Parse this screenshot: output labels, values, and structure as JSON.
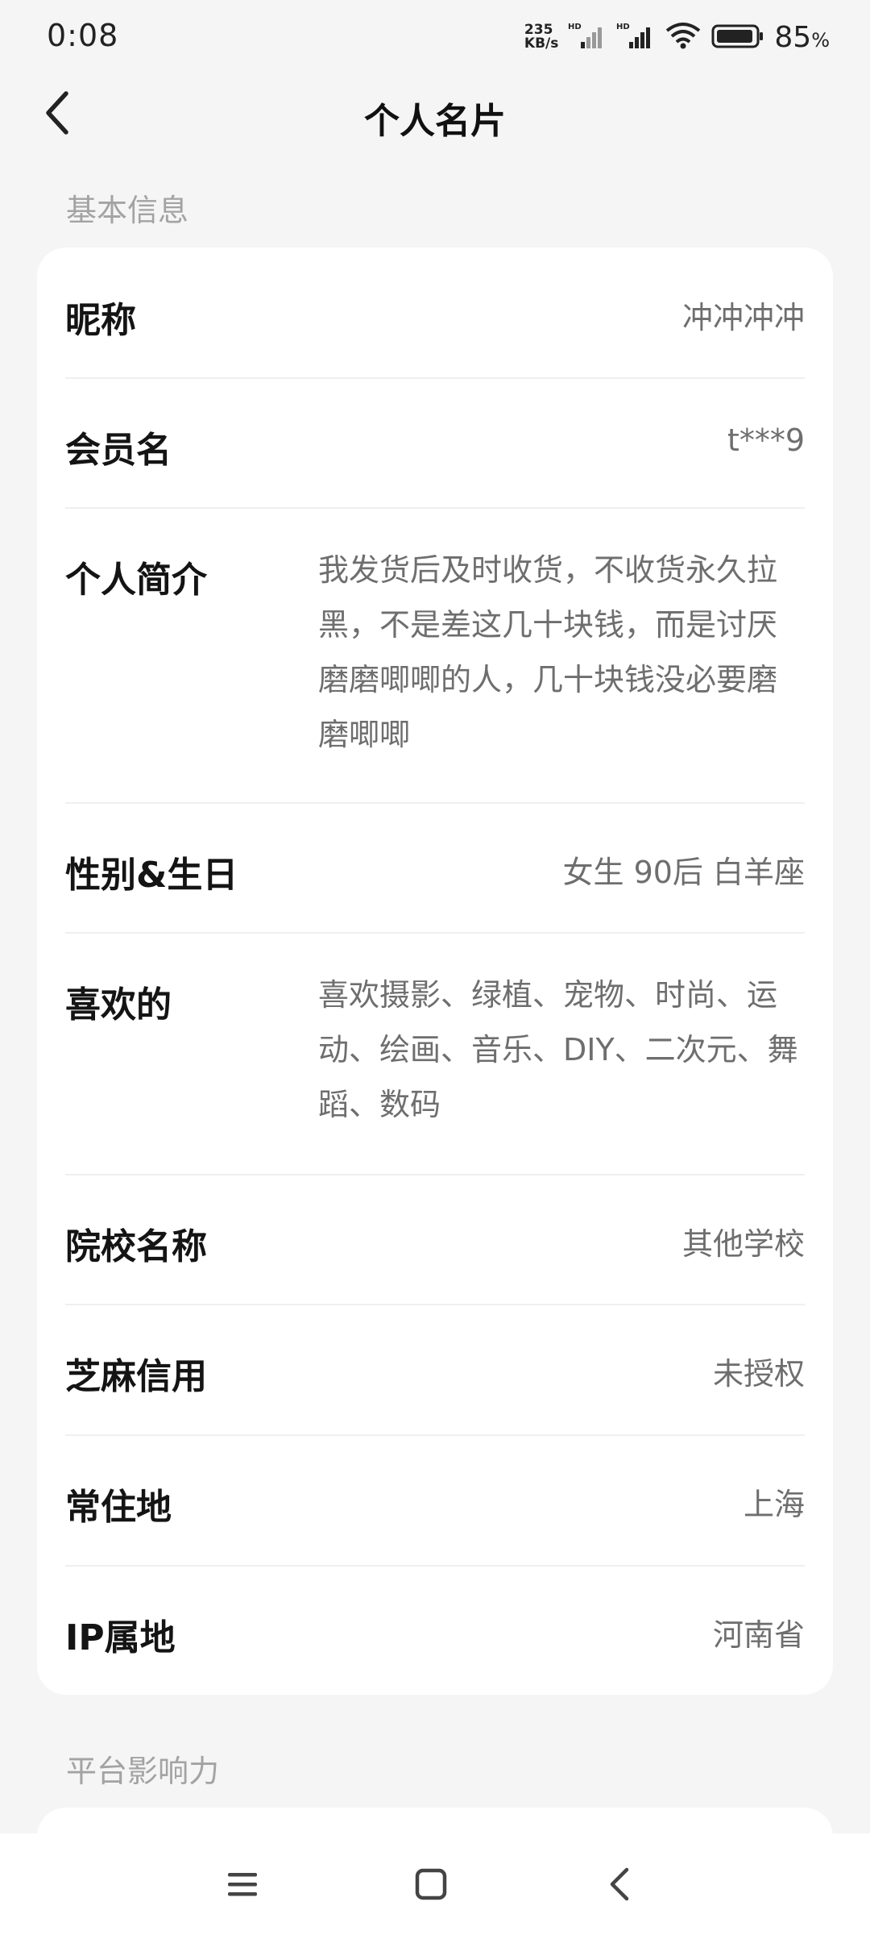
{
  "status_bar": {
    "time": "0:08",
    "net_speed_value": "235",
    "net_speed_unit": "KB/s",
    "battery_percent": "85",
    "battery_unit": "%",
    "icons": [
      "hd-signal-icon",
      "hd-signal-icon",
      "wifi-icon",
      "battery-icon"
    ]
  },
  "header": {
    "title": "个人名片",
    "back_icon": "chevron-left-icon"
  },
  "basic_info": {
    "section_label": "基本信息",
    "rows": [
      {
        "label": "昵称",
        "value": "冲冲冲冲"
      },
      {
        "label": "会员名",
        "value": "t***9"
      },
      {
        "label": "个人简介",
        "value": "我发货后及时收货，不收货永久拉黑，不是差这几十块钱，而是讨厌磨磨唧唧的人，几十块钱没必要磨磨唧唧"
      },
      {
        "label": "性别&生日",
        "value": "女生 90后 白羊座"
      },
      {
        "label": "喜欢的",
        "value": "喜欢摄影、绿植、宠物、时尚、运动、绘画、音乐、DIY、二次元、舞蹈、数码"
      },
      {
        "label": "院校名称",
        "value": "其他学校"
      },
      {
        "label": "芝麻信用",
        "value": "未授权"
      },
      {
        "label": "常住地",
        "value": "上海"
      },
      {
        "label": "IP属地",
        "value": "河南省"
      }
    ]
  },
  "platform_influence": {
    "section_label": "平台影响力"
  },
  "nav_bar": {
    "icons": [
      "menu-icon",
      "home-icon",
      "back-icon"
    ]
  }
}
